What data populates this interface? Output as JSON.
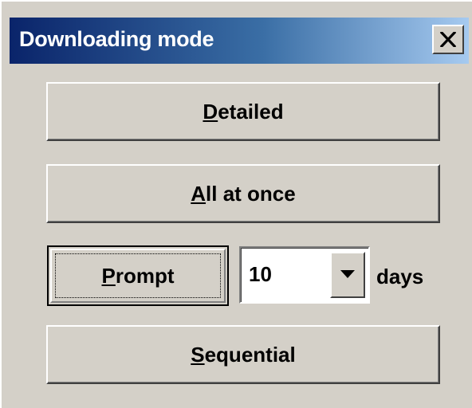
{
  "window": {
    "title": "Downloading mode",
    "close_icon": "close-icon"
  },
  "buttons": {
    "detailed": {
      "mnemonic": "D",
      "rest": "etailed"
    },
    "all_at_once": {
      "mnemonic": "A",
      "rest": "ll at once"
    },
    "prompt": {
      "mnemonic": "P",
      "rest": "rompt"
    },
    "sequential": {
      "mnemonic": "S",
      "rest": "equential"
    }
  },
  "days_combo": {
    "value": "10",
    "arrow_icon": "chevron-down-icon"
  },
  "days_label": "days",
  "colors": {
    "face": "#d4d0c8",
    "title_start": "#0a246a",
    "title_end": "#a6caf0"
  }
}
